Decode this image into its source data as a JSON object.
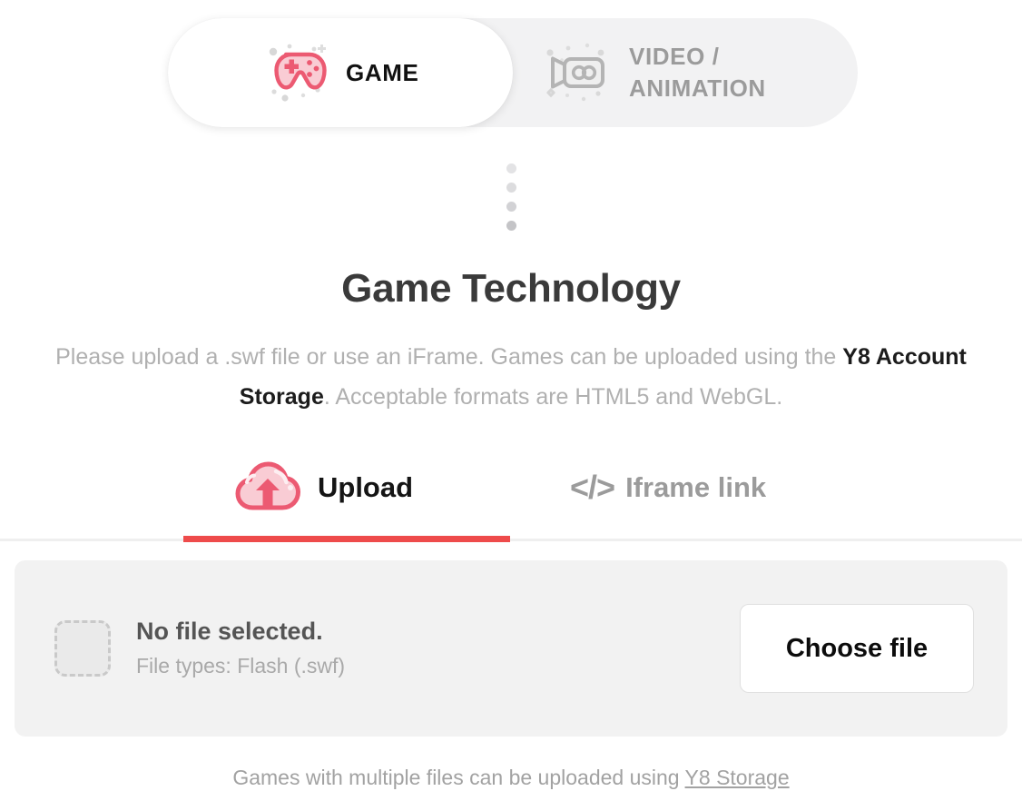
{
  "type_switch": {
    "active": "GAME",
    "options": [
      {
        "label": "GAME",
        "icon": "gamepad-icon",
        "active": true
      },
      {
        "label": "VIDEO /\nANIMATION",
        "icon": "video-camera-icon",
        "active": false
      }
    ]
  },
  "separator": {
    "icon": "vertical-dots-icon",
    "dot_count": 4
  },
  "heading": {
    "title": "Game Technology"
  },
  "description": {
    "part1": "Please upload a .swf file or use an iFrame. Games can be uploaded using the ",
    "emphasis": "Y8 Account Storage",
    "part2": ". Acceptable formats are HTML5 and WebGL."
  },
  "method_tabs": {
    "active": "Upload",
    "items": [
      {
        "label": "Upload",
        "icon": "cloud-upload-icon",
        "active": true
      },
      {
        "label": "Iframe link",
        "icon": "code-brackets-icon",
        "active": false
      }
    ],
    "active_underline_color": "#ee4b4b"
  },
  "file_picker": {
    "thumbnail_icon": "empty-file-placeholder-icon",
    "file_name": "No file selected.",
    "file_types": "File types: Flash (.swf)",
    "choose_button": "Choose file"
  },
  "footer": {
    "text_before": "Games with multiple files can be uploaded using ",
    "link_text": "Y8 Storage"
  },
  "colors": {
    "accent_red": "#ee4b4b",
    "pink_fill": "#f9ccd4",
    "pink_stroke": "#ec5a72",
    "muted_gray": "#9b9b9b",
    "panel_gray": "#f2f2f2"
  }
}
